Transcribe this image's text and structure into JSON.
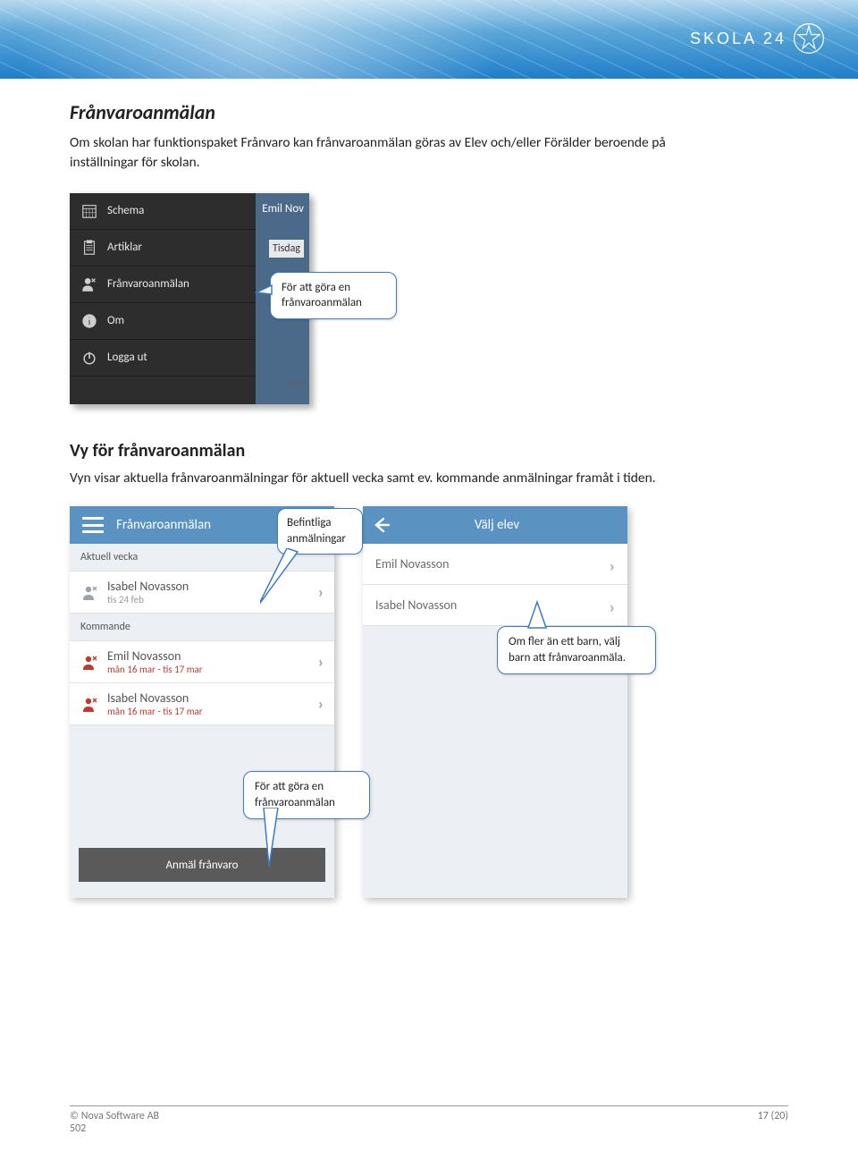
{
  "header": {
    "logo_text": "SKOLA 24"
  },
  "sec1": {
    "title": "Frånvaroanmälan",
    "lead": "Om skolan har funktionspaket Frånvaro kan frånvaroanmälan göras av Elev och/eller Förälder beroende på inställningar för skolan."
  },
  "shot1": {
    "right_name": "Emil Nov",
    "right_day": "Tisdag",
    "right_susa": "Susa",
    "menu": {
      "schema": "Schema",
      "artiklar": "Artiklar",
      "franvaro": "Frånvaroanmälan",
      "om": "Om",
      "logga": "Logga ut"
    },
    "callout": "För att göra en frånvaroanmälan"
  },
  "sec2": {
    "title": "Vy för frånvaroanmälan",
    "lead": "Vyn visar aktuella frånvaroanmälningar för aktuell vecka samt ev. kommande anmälningar framåt i tiden."
  },
  "phones": {
    "left": {
      "title": "Frånvaroanmälan",
      "sec_aktuell": "Aktuell vecka",
      "item1_name": "Isabel Novasson",
      "item1_date": "tis 24 feb",
      "sec_kommande": "Kommande",
      "item2_name": "Emil Novasson",
      "item2_date": "mån 16 mar - tis 17 mar",
      "item3_name": "Isabel Novasson",
      "item3_date": "mån 16 mar - tis 17 mar",
      "footer": "Anmäl frånvaro"
    },
    "right": {
      "title": "Välj elev",
      "item1": "Emil Novasson",
      "item2": "Isabel Novasson"
    },
    "callout_befintliga": "Befintliga anmälningar",
    "callout_barn": "Om fler än ett barn, välj barn att frånvaroanmäla.",
    "callout_anmal": "För att göra en frånvaroanmälan"
  },
  "footer": {
    "left_line1": "© Nova Software AB",
    "left_line2": "502",
    "right": "17 (20)"
  }
}
